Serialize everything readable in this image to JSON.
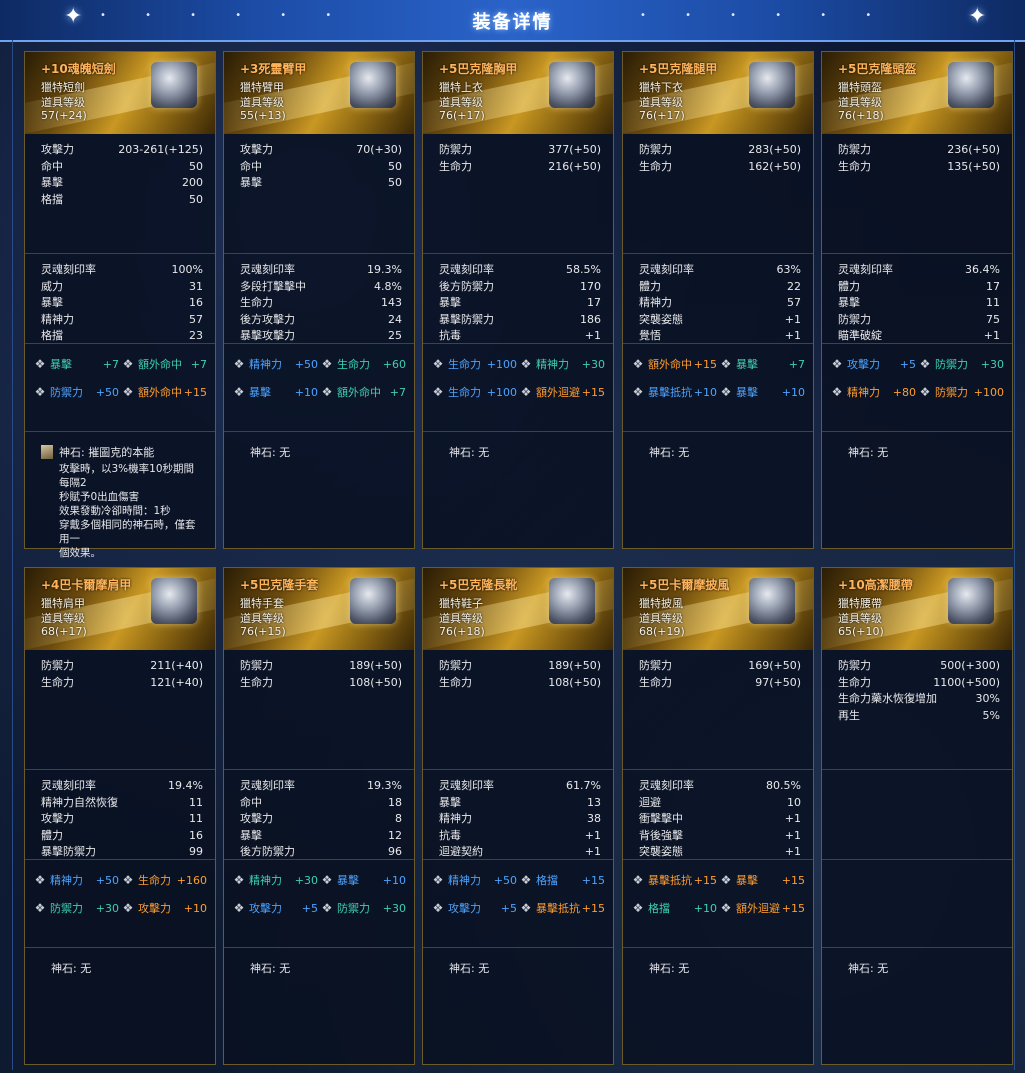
{
  "header": {
    "title": "装备详情"
  },
  "cards": [
    {
      "name": "+10魂魄短劍",
      "type": "獵特短劍",
      "level_label": "道具等级",
      "level": "57(+24)",
      "stats": [
        [
          "攻擊力",
          "203-261(+125)"
        ],
        [
          "命中",
          "50"
        ],
        [
          "暴擊",
          "200"
        ],
        [
          "格擋",
          "50"
        ]
      ],
      "soul": [
        [
          "灵魂刻印率",
          "100%"
        ],
        [
          "威力",
          "31"
        ],
        [
          "暴擊",
          "16"
        ],
        [
          "精神力",
          "57"
        ],
        [
          "格擋",
          "23"
        ]
      ],
      "gems": [
        [
          {
            "n": "暴擊",
            "v": "+7",
            "c": "c-teal"
          },
          {
            "n": "額外命中",
            "v": "+7",
            "c": "c-teal"
          }
        ],
        [
          {
            "n": "防禦力",
            "v": "+50",
            "c": "c-blue"
          },
          {
            "n": "額外命中",
            "v": "+15",
            "c": "c-orange"
          }
        ]
      ],
      "stone_label": "神石: 摧圖克的本能",
      "stone_desc": [
        "攻擊時，以3%機率10秒期間每隔2",
        "秒賦予0出血傷害",
        "效果發動冷卻時間：1秒",
        "穿戴多個相同的神石時，僅套用一",
        "個效果。"
      ]
    },
    {
      "name": "+3死靈臂甲",
      "type": "獵特臂甲",
      "level_label": "道具等级",
      "level": "55(+13)",
      "stats": [
        [
          "攻擊力",
          "70(+30)"
        ],
        [
          "命中",
          "50"
        ],
        [
          "暴擊",
          "50"
        ]
      ],
      "soul": [
        [
          "灵魂刻印率",
          "19.3%"
        ],
        [
          "多段打擊擊中",
          "4.8%"
        ],
        [
          "生命力",
          "143"
        ],
        [
          "後方攻擊力",
          "24"
        ],
        [
          "暴擊攻擊力",
          "25"
        ]
      ],
      "gems": [
        [
          {
            "n": "精神力",
            "v": "+50",
            "c": "c-blue"
          },
          {
            "n": "生命力",
            "v": "+60",
            "c": "c-teal"
          }
        ],
        [
          {
            "n": "暴擊",
            "v": "+10",
            "c": "c-blue"
          },
          {
            "n": "額外命中",
            "v": "+7",
            "c": "c-teal"
          }
        ]
      ],
      "stone_label": "神石: 无",
      "stone_desc": []
    },
    {
      "name": "+5巴克隆胸甲",
      "type": "獵特上衣",
      "level_label": "道具等级",
      "level": "76(+17)",
      "stats": [
        [
          "防禦力",
          "377(+50)"
        ],
        [
          "生命力",
          "216(+50)"
        ]
      ],
      "soul": [
        [
          "灵魂刻印率",
          "58.5%"
        ],
        [
          "後方防禦力",
          "170"
        ],
        [
          "暴擊",
          "17"
        ],
        [
          "暴擊防禦力",
          "186"
        ],
        [
          "抗毒",
          "+1"
        ]
      ],
      "gems": [
        [
          {
            "n": "生命力",
            "v": "+100",
            "c": "c-blue"
          },
          {
            "n": "精神力",
            "v": "+30",
            "c": "c-teal"
          }
        ],
        [
          {
            "n": "生命力",
            "v": "+100",
            "c": "c-blue"
          },
          {
            "n": "額外迴避",
            "v": "+15",
            "c": "c-orange"
          }
        ]
      ],
      "stone_label": "神石: 无",
      "stone_desc": []
    },
    {
      "name": "+5巴克隆腿甲",
      "type": "獵特下衣",
      "level_label": "道具等级",
      "level": "76(+17)",
      "stats": [
        [
          "防禦力",
          "283(+50)"
        ],
        [
          "生命力",
          "162(+50)"
        ]
      ],
      "soul": [
        [
          "灵魂刻印率",
          "63%"
        ],
        [
          "體力",
          "22"
        ],
        [
          "精神力",
          "57"
        ],
        [
          "突襲姿態",
          "+1"
        ],
        [
          "覺悟",
          "+1"
        ]
      ],
      "gems": [
        [
          {
            "n": "額外命中",
            "v": "+15",
            "c": "c-orange"
          },
          {
            "n": "暴擊",
            "v": "+7",
            "c": "c-teal"
          }
        ],
        [
          {
            "n": "暴擊抵抗",
            "v": "+10",
            "c": "c-blue"
          },
          {
            "n": "暴擊",
            "v": "+10",
            "c": "c-blue"
          }
        ]
      ],
      "stone_label": "神石: 无",
      "stone_desc": []
    },
    {
      "name": "+5巴克隆頭盔",
      "type": "獵特頭盔",
      "level_label": "道具等级",
      "level": "76(+18)",
      "stats": [
        [
          "防禦力",
          "236(+50)"
        ],
        [
          "生命力",
          "135(+50)"
        ]
      ],
      "soul": [
        [
          "灵魂刻印率",
          "36.4%"
        ],
        [
          "體力",
          "17"
        ],
        [
          "暴擊",
          "11"
        ],
        [
          "防禦力",
          "75"
        ],
        [
          "瞄準破綻",
          "+1"
        ]
      ],
      "gems": [
        [
          {
            "n": "攻擊力",
            "v": "+5",
            "c": "c-blue"
          },
          {
            "n": "防禦力",
            "v": "+30",
            "c": "c-teal"
          }
        ],
        [
          {
            "n": "精神力",
            "v": "+80",
            "c": "c-orange"
          },
          {
            "n": "防禦力",
            "v": "+100",
            "c": "c-orange"
          }
        ]
      ],
      "stone_label": "神石: 无",
      "stone_desc": []
    },
    {
      "name": "+4巴卡爾摩肩甲",
      "type": "獵特肩甲",
      "level_label": "道具等级",
      "level": "68(+17)",
      "stats": [
        [
          "防禦力",
          "211(+40)"
        ],
        [
          "生命力",
          "121(+40)"
        ]
      ],
      "soul": [
        [
          "灵魂刻印率",
          "19.4%"
        ],
        [
          "精神力自然恢復",
          "11"
        ],
        [
          "攻擊力",
          "11"
        ],
        [
          "體力",
          "16"
        ],
        [
          "暴擊防禦力",
          "99"
        ]
      ],
      "gems": [
        [
          {
            "n": "精神力",
            "v": "+50",
            "c": "c-blue"
          },
          {
            "n": "生命力",
            "v": "+160",
            "c": "c-orange"
          }
        ],
        [
          {
            "n": "防禦力",
            "v": "+30",
            "c": "c-teal"
          },
          {
            "n": "攻擊力",
            "v": "+10",
            "c": "c-orange"
          }
        ]
      ],
      "stone_label": "神石: 无",
      "stone_desc": []
    },
    {
      "name": "+5巴克隆手套",
      "type": "獵特手套",
      "level_label": "道具等级",
      "level": "76(+15)",
      "stats": [
        [
          "防禦力",
          "189(+50)"
        ],
        [
          "生命力",
          "108(+50)"
        ]
      ],
      "soul": [
        [
          "灵魂刻印率",
          "19.3%"
        ],
        [
          "命中",
          "18"
        ],
        [
          "攻擊力",
          "8"
        ],
        [
          "暴擊",
          "12"
        ],
        [
          "後方防禦力",
          "96"
        ]
      ],
      "gems": [
        [
          {
            "n": "精神力",
            "v": "+30",
            "c": "c-teal"
          },
          {
            "n": "暴擊",
            "v": "+10",
            "c": "c-blue"
          }
        ],
        [
          {
            "n": "攻擊力",
            "v": "+5",
            "c": "c-blue"
          },
          {
            "n": "防禦力",
            "v": "+30",
            "c": "c-teal"
          }
        ]
      ],
      "stone_label": "神石: 无",
      "stone_desc": []
    },
    {
      "name": "+5巴克隆長靴",
      "type": "獵特鞋子",
      "level_label": "道具等级",
      "level": "76(+18)",
      "stats": [
        [
          "防禦力",
          "189(+50)"
        ],
        [
          "生命力",
          "108(+50)"
        ]
      ],
      "soul": [
        [
          "灵魂刻印率",
          "61.7%"
        ],
        [
          "暴擊",
          "13"
        ],
        [
          "精神力",
          "38"
        ],
        [
          "抗毒",
          "+1"
        ],
        [
          "迴避契約",
          "+1"
        ]
      ],
      "gems": [
        [
          {
            "n": "精神力",
            "v": "+50",
            "c": "c-blue"
          },
          {
            "n": "格擋",
            "v": "+15",
            "c": "c-blue"
          }
        ],
        [
          {
            "n": "攻擊力",
            "v": "+5",
            "c": "c-blue"
          },
          {
            "n": "暴擊抵抗",
            "v": "+15",
            "c": "c-orange"
          }
        ]
      ],
      "stone_label": "神石: 无",
      "stone_desc": []
    },
    {
      "name": "+5巴卡爾摩披風",
      "type": "獵特披風",
      "level_label": "道具等级",
      "level": "68(+19)",
      "stats": [
        [
          "防禦力",
          "169(+50)"
        ],
        [
          "生命力",
          "97(+50)"
        ]
      ],
      "soul": [
        [
          "灵魂刻印率",
          "80.5%"
        ],
        [
          "迴避",
          "10"
        ],
        [
          "衝擊擊中",
          "+1"
        ],
        [
          "背後強擊",
          "+1"
        ],
        [
          "突襲姿態",
          "+1"
        ]
      ],
      "gems": [
        [
          {
            "n": "暴擊抵抗",
            "v": "+15",
            "c": "c-orange"
          },
          {
            "n": "暴擊",
            "v": "+15",
            "c": "c-orange"
          }
        ],
        [
          {
            "n": "格擋",
            "v": "+10",
            "c": "c-teal"
          },
          {
            "n": "額外迴避",
            "v": "+15",
            "c": "c-orange"
          }
        ]
      ],
      "stone_label": "神石: 无",
      "stone_desc": []
    },
    {
      "name": "+10高潔腰帶",
      "type": "獵特腰帶",
      "level_label": "道具等级",
      "level": "65(+10)",
      "stats": [
        [
          "防禦力",
          "500(+300)"
        ],
        [
          "生命力",
          "1100(+500)"
        ],
        [
          "生命力藥水恢復增加",
          "30%"
        ],
        [
          "再生",
          "5%"
        ]
      ],
      "soul": [],
      "gems": [],
      "stone_label": "神石: 无",
      "stone_desc": []
    }
  ]
}
